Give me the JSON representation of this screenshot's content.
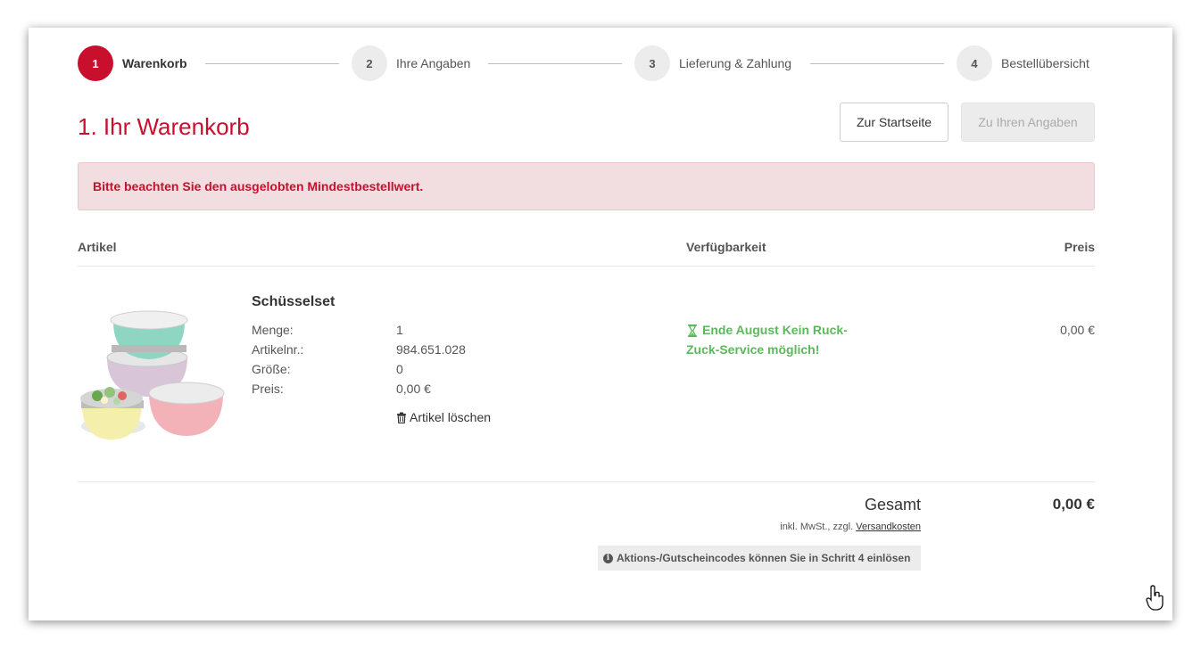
{
  "stepper": {
    "steps": [
      {
        "number": "1",
        "label": "Warenkorb",
        "active": true
      },
      {
        "number": "2",
        "label": "Ihre Angaben",
        "active": false
      },
      {
        "number": "3",
        "label": "Lieferung & Zahlung",
        "active": false
      },
      {
        "number": "4",
        "label": "Bestellübersicht",
        "active": false
      }
    ]
  },
  "header": {
    "title": "1. Ihr Warenkorb",
    "home_button": "Zur Startseite",
    "next_button": "Zu Ihren Angaben"
  },
  "alert": {
    "message": "Bitte beachten Sie den ausgelobten Mindestbestellwert."
  },
  "table": {
    "headers": {
      "article": "Artikel",
      "availability": "Verfügbarkeit",
      "price": "Preis"
    }
  },
  "item": {
    "name": "Schüsselset",
    "details": [
      {
        "label": "Menge:",
        "value": "1"
      },
      {
        "label": "Artikelnr.:",
        "value": "984.651.028"
      },
      {
        "label": "Größe:",
        "value": "0"
      },
      {
        "label": "Preis:",
        "value": "0,00 €"
      }
    ],
    "delete_label": "Artikel löschen",
    "availability": "Ende August  Kein Ruck-Zuck-Service möglich!",
    "price": "0,00 €"
  },
  "summary": {
    "total_label": "Gesamt",
    "total_value": "0,00 €",
    "tax_note_prefix": "inkl. MwSt., zzgl. ",
    "shipping_link": "Versandkosten",
    "voucher_note": "Aktions-/Gutscheincodes können Sie in Schritt 4 einlösen"
  },
  "colors": {
    "brand": "#c8102e",
    "availability": "#5cb85c",
    "alert_bg": "#f2dde0"
  },
  "icons": {
    "delete": "trash-icon",
    "availability": "hourglass-icon",
    "voucher": "info-icon"
  }
}
